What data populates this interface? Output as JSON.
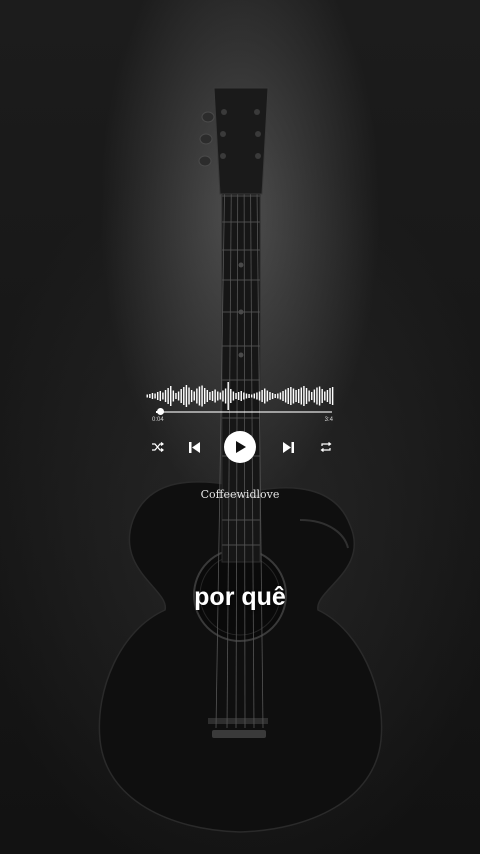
{
  "player": {
    "time_elapsed": "0:04",
    "time_total": "3:4",
    "progress": 0.02,
    "artist": "Coffeewidlove",
    "waveform": [
      3,
      4,
      6,
      5,
      8,
      10,
      7,
      12,
      16,
      20,
      11,
      6,
      9,
      14,
      18,
      22,
      17,
      12,
      9,
      15,
      19,
      21,
      16,
      12,
      8,
      10,
      13,
      9,
      7,
      11,
      15,
      28,
      14,
      9,
      6,
      8,
      10,
      7,
      5,
      4,
      3,
      5,
      7,
      9,
      12,
      15,
      11,
      8,
      6,
      4,
      5,
      7,
      10,
      13,
      16,
      18,
      15,
      12,
      14,
      17,
      20,
      16,
      11,
      8,
      13,
      17,
      19,
      14,
      9,
      12,
      16,
      18
    ]
  },
  "controls": {
    "shuffle_icon": "shuffle-icon",
    "previous_icon": "skip-previous-icon",
    "play_icon": "play-icon",
    "next_icon": "skip-next-icon",
    "repeat_icon": "repeat-icon"
  },
  "lyric": "por quê",
  "background_icon": "acoustic-guitar"
}
